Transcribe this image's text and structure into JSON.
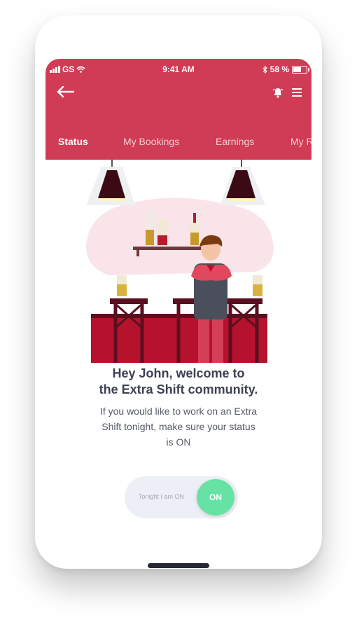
{
  "status_bar": {
    "carrier": "GS",
    "time": "9:41 AM",
    "battery": "58 %"
  },
  "header": {
    "tabs": [
      {
        "label": "Status",
        "active": true
      },
      {
        "label": "My Bookings",
        "active": false
      },
      {
        "label": "Earnings",
        "active": false
      },
      {
        "label": "My R",
        "active": false
      }
    ]
  },
  "main": {
    "heading_line1": "Hey John, welcome to",
    "heading_line2": "the Extra Shift community.",
    "body_line1": "If you would like to work on an Extra",
    "body_line2": "Shift tonight, make sure your status",
    "body_line3": "is ON"
  },
  "toggle": {
    "label": "Tonight I am ON",
    "state": "ON",
    "on_color": "#66e3a4"
  },
  "colors": {
    "brand": "#d03b55",
    "heading": "#3c4152"
  },
  "icons": [
    "back-arrow-icon",
    "bell-icon",
    "menu-icon",
    "wifi-icon",
    "bluetooth-icon",
    "battery-icon",
    "signal-icon"
  ]
}
